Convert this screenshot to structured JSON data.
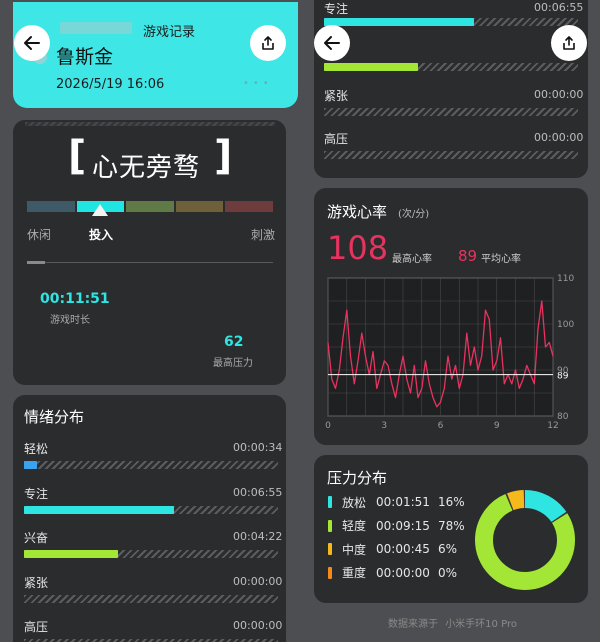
{
  "header": {
    "blurred_text": "",
    "title": "游戏记录",
    "game_name": "鲁斯金",
    "datetime": "2026/5/19 16:06"
  },
  "mood": {
    "title": "心无旁骛",
    "bracket_left": "[",
    "bracket_right": "]",
    "scale_labels": [
      "休闲",
      "投入",
      "刺激"
    ],
    "segment_colors": [
      "#3d5a66",
      "#1fe6e2",
      "#6d8a4a",
      "#7d6a3a",
      "#7a4040"
    ]
  },
  "stats": {
    "duration_value": "00:11:51",
    "duration_label": "游戏时长",
    "max_pressure_value": "62",
    "max_pressure_label": "最高压力"
  },
  "emotion": {
    "title": "情绪分布",
    "items": [
      {
        "label": "轻松",
        "time": "00:00:34",
        "fraction": 0.05,
        "color": "#3aa3f0"
      },
      {
        "label": "专注",
        "time": "00:06:55",
        "fraction": 0.59,
        "color": "#2ee5e2"
      },
      {
        "label": "兴奋",
        "time": "00:04:22",
        "fraction": 0.37,
        "color": "#a4e635"
      },
      {
        "label": "紧张",
        "time": "00:00:00",
        "fraction": 0,
        "color": "#888888"
      },
      {
        "label": "高压",
        "time": "00:00:00",
        "fraction": 0,
        "color": "#888888"
      }
    ]
  },
  "right_top": {
    "rows": [
      {
        "label": "专注",
        "time": "00:06:55",
        "fraction": 0.59,
        "color": "#2ee5e2"
      },
      {
        "label": "",
        "time": "",
        "fraction": 0.37,
        "color": "#a4e635"
      },
      {
        "label": "紧张",
        "time": "00:00:00",
        "fraction": 0,
        "color": "#888888"
      },
      {
        "label": "高压",
        "time": "00:00:00",
        "fraction": 0,
        "color": "#888888"
      }
    ]
  },
  "heart": {
    "title": "游戏心率",
    "unit": "(次/分)",
    "max_value": "108",
    "max_label": "最高心率",
    "avg_value": "89",
    "avg_label": "平均心率",
    "avg_marker": "89"
  },
  "pressure": {
    "title": "压力分布",
    "items": [
      {
        "label": "放松",
        "time": "00:01:51",
        "pct": "16%",
        "value": 16,
        "color": "#2ee5e2"
      },
      {
        "label": "轻度",
        "time": "00:09:15",
        "pct": "78%",
        "value": 78,
        "color": "#a4e635"
      },
      {
        "label": "中度",
        "time": "00:00:45",
        "pct": "6%",
        "value": 6,
        "color": "#f5b91c"
      },
      {
        "label": "重度",
        "time": "00:00:00",
        "pct": "0%",
        "value": 0,
        "color": "#f5891c"
      }
    ]
  },
  "footer": {
    "source_prefix": "数据来源于",
    "device": "小米手环10 Pro"
  },
  "chart_data": {
    "type": "line",
    "title": "游戏心率",
    "xlabel": "",
    "ylabel": "",
    "xlim": [
      0,
      12
    ],
    "ylim": [
      80,
      110
    ],
    "xticks": [
      0,
      3,
      6,
      9,
      12
    ],
    "yticks": [
      80,
      90,
      100,
      110
    ],
    "reference_line": 89,
    "grid": true,
    "series": [
      {
        "color": "#e8325f",
        "x": [
          0,
          0.2,
          0.4,
          0.6,
          0.8,
          1.0,
          1.2,
          1.4,
          1.6,
          1.8,
          2.0,
          2.2,
          2.4,
          2.6,
          2.8,
          3.0,
          3.2,
          3.4,
          3.6,
          3.8,
          4.0,
          4.2,
          4.4,
          4.6,
          4.8,
          5.0,
          5.2,
          5.4,
          5.6,
          5.8,
          6.0,
          6.2,
          6.4,
          6.6,
          6.8,
          7.0,
          7.2,
          7.4,
          7.6,
          7.8,
          8.0,
          8.2,
          8.4,
          8.6,
          8.8,
          9.0,
          9.2,
          9.4,
          9.6,
          9.8,
          10.0,
          10.2,
          10.4,
          10.6,
          10.8,
          11.0,
          11.2,
          11.4,
          11.6,
          11.8,
          12.0
        ],
        "values": [
          96,
          88,
          86,
          90,
          97,
          103,
          93,
          87,
          92,
          98,
          93,
          89,
          94,
          86,
          89,
          92,
          91,
          87,
          84,
          89,
          93,
          88,
          85,
          91,
          84,
          86,
          92,
          87,
          84,
          82,
          83,
          86,
          93,
          88,
          91,
          86,
          89,
          98,
          91,
          95,
          90,
          93,
          103,
          101,
          90,
          92,
          97,
          87,
          89,
          87,
          90,
          86,
          88,
          91,
          89,
          87,
          99,
          105,
          95,
          96,
          93
        ]
      }
    ]
  }
}
